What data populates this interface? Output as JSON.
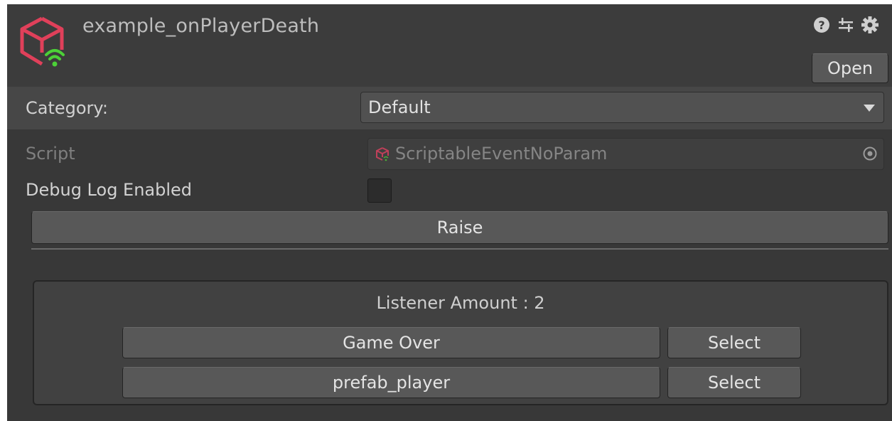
{
  "header": {
    "title": "example_onPlayerDeath",
    "asset_icon": "scriptable-event-icon",
    "icons": [
      "help-icon",
      "preset-icon",
      "gear-icon"
    ],
    "open_label": "Open"
  },
  "category": {
    "label": "Category:",
    "value": "Default"
  },
  "fields": {
    "script_label": "Script",
    "script_value": "ScriptableEventNoParam",
    "debug_label": "Debug Log Enabled",
    "debug_enabled": false
  },
  "raise_label": "Raise",
  "listeners": {
    "title": "Listener Amount : 2",
    "items": [
      {
        "name": "Game Over",
        "select_label": "Select"
      },
      {
        "name": "prefab_player",
        "select_label": "Select"
      }
    ]
  },
  "colors": {
    "accent_red": "#e0405a",
    "accent_green": "#4cd137",
    "panel_bg": "#383838"
  }
}
